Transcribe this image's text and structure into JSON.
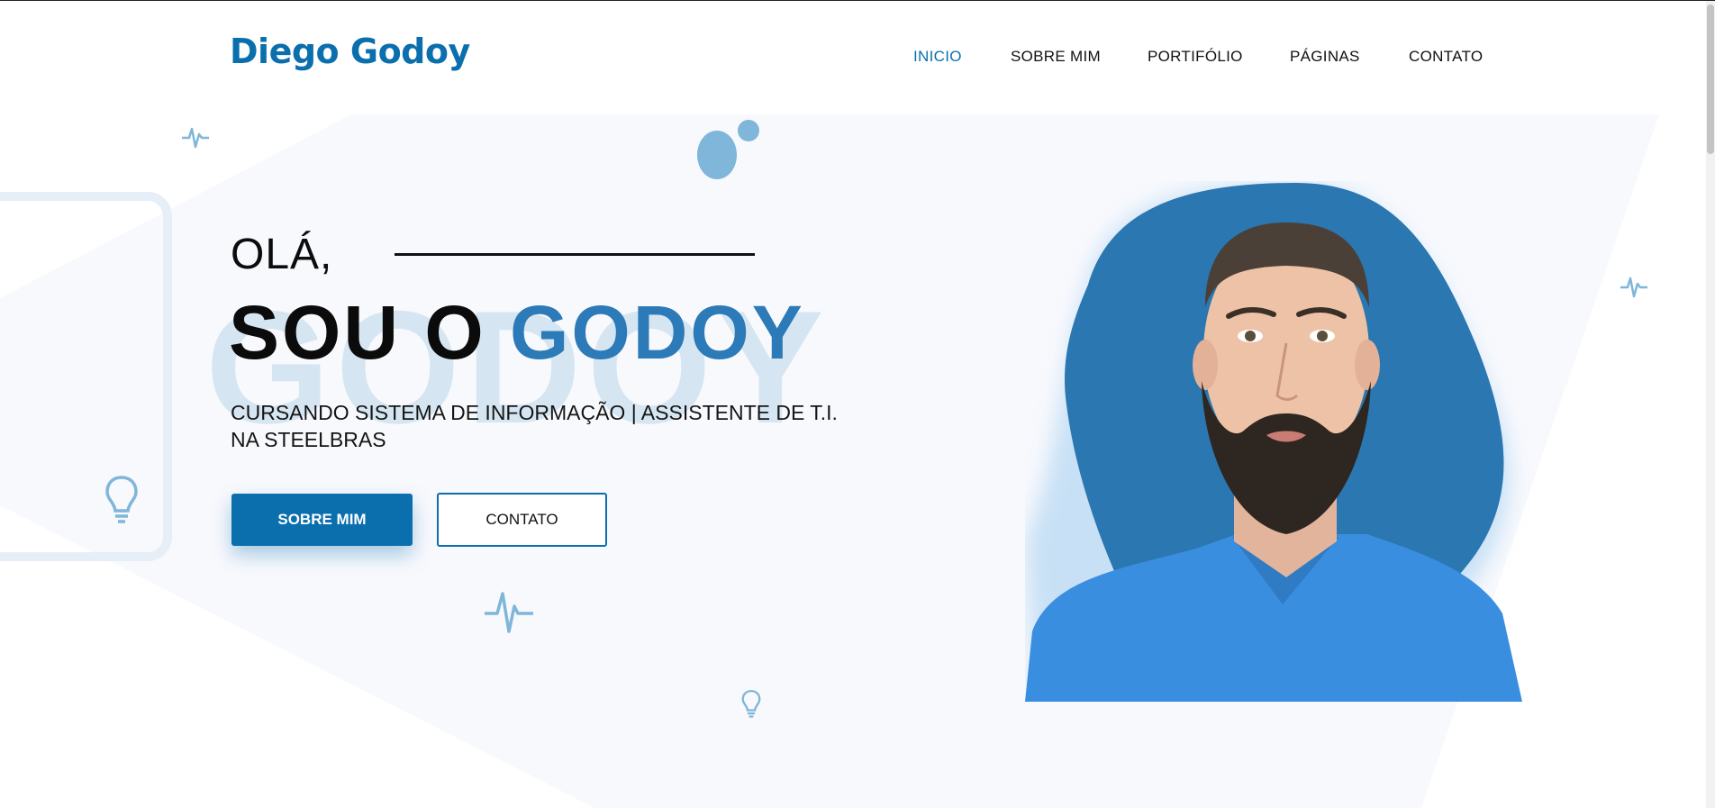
{
  "header": {
    "logo": "Diego Godoy",
    "nav": [
      {
        "label": "INICIO",
        "active": true
      },
      {
        "label": "SOBRE MIM",
        "active": false
      },
      {
        "label": "PORTIFÓLIO",
        "active": false
      },
      {
        "label": "PÁGINAS",
        "active": false
      },
      {
        "label": "CONTATO",
        "active": false
      }
    ]
  },
  "hero": {
    "greeting": "OLÁ,",
    "headline_prefix": "SOU O ",
    "headline_highlight": "GODOY",
    "watermark": "GODOY",
    "subtitle": "CURSANDO SISTEMA DE INFORMAÇÃO | ASSISTENTE DE T.I. NA STEELBRAS",
    "buttons": {
      "primary": "SOBRE MIM",
      "secondary": "CONTATO"
    }
  },
  "decorations": [
    "pulse-icon",
    "lightbulb-icon",
    "bubbles"
  ],
  "colors": {
    "brand": "#0b6fae",
    "highlight": "#2c7ab8",
    "blob": "#2b77b1",
    "watermark": "#d5e6f2",
    "deco": "#7fb6d9"
  },
  "portrait": {
    "icon": "person-portrait"
  }
}
